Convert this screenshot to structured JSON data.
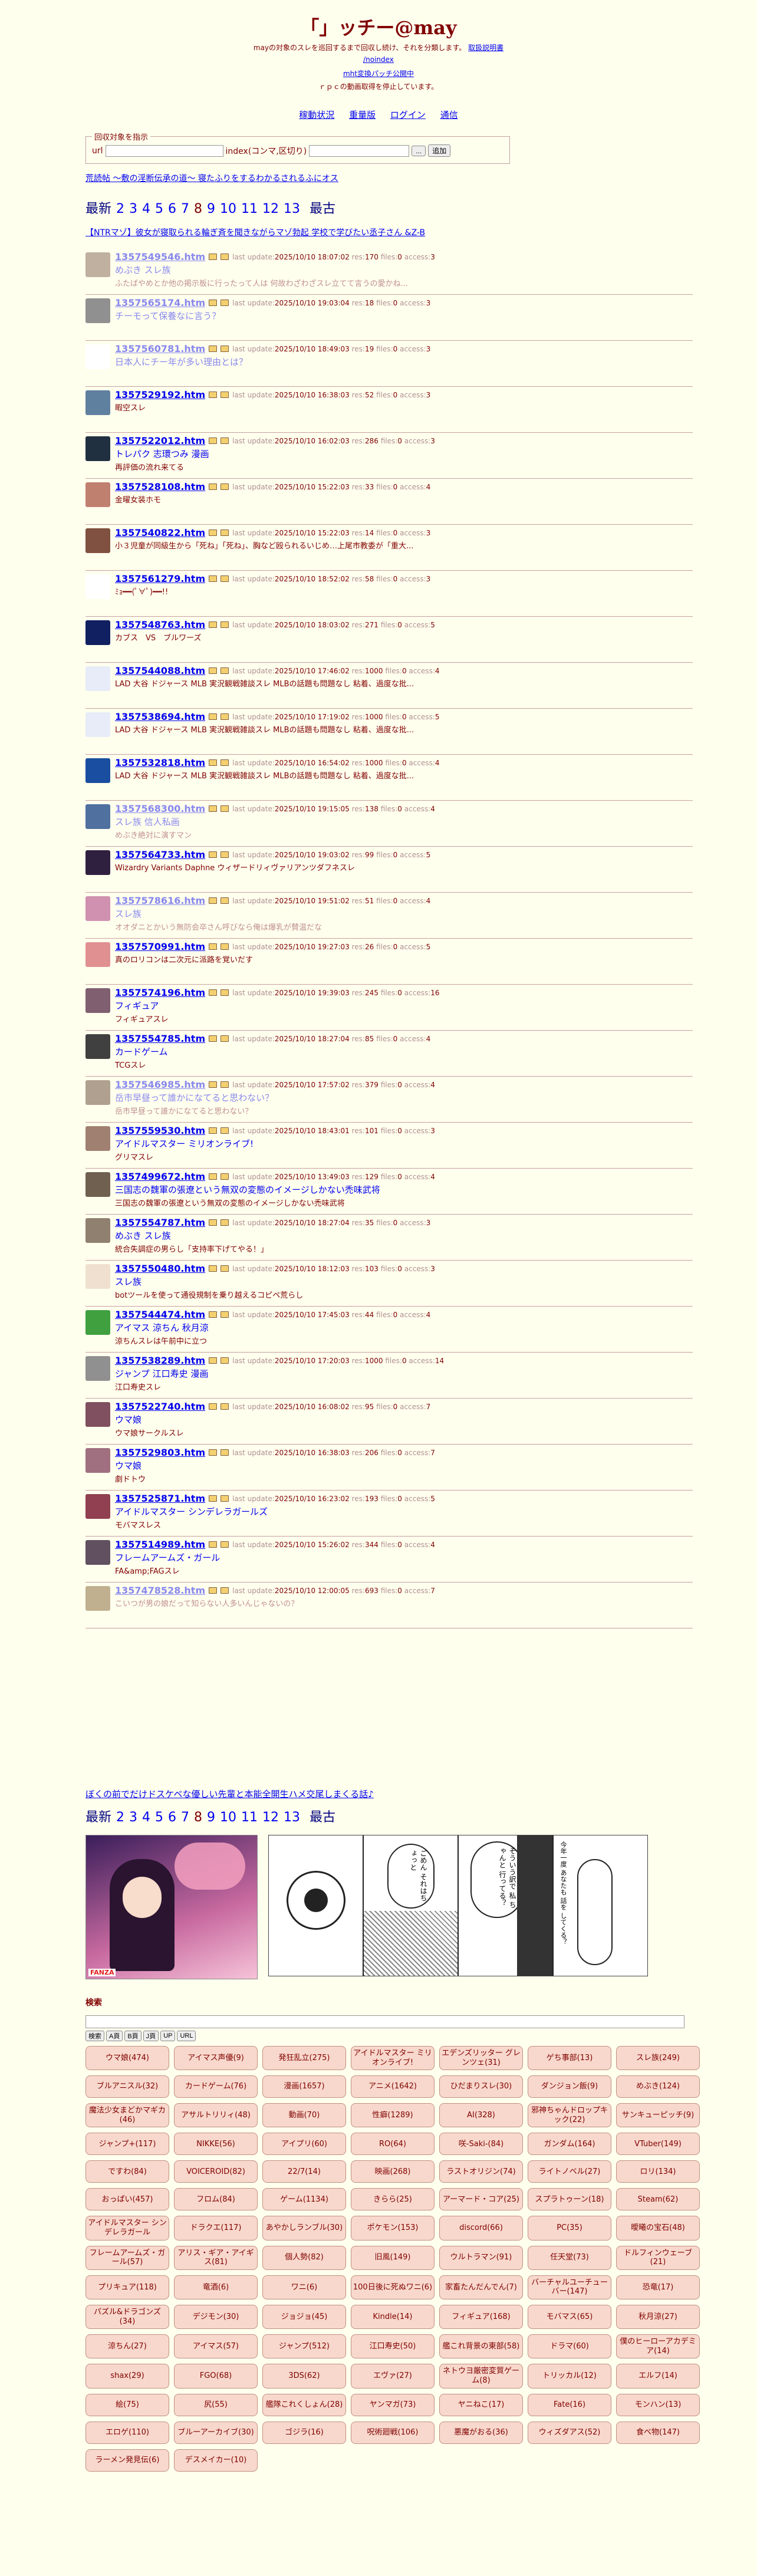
{
  "site_title": "「」ッチー@may",
  "intro": {
    "line1": "mayの対象のスレを巡回するまで回収し続け、それを分類します。",
    "line1_link": "取扱説明書",
    "line2": "/noindex",
    "line3": "mht変換パッチ公開中",
    "line4": "ｒｐｃの動画取得を停止しています。"
  },
  "nav": [
    "稼動状況",
    "重量版",
    "ログイン",
    "通信"
  ],
  "form": {
    "legend": "回収対象を指示",
    "url_label": "url",
    "index_label": "index(コンマ,区切り)",
    "dots_button": "...",
    "add_button": "追加"
  },
  "tag_links": "荒読帖 〜敷の淫断伝承の道〜 寝たふりをするわかるされるふにオス",
  "pager": {
    "label_first": "最新",
    "pages": [
      "2",
      "3",
      "4",
      "5",
      "6",
      "7",
      "8",
      "9",
      "10",
      "11",
      "12",
      "13"
    ],
    "current": "8",
    "label_last": "最古"
  },
  "selection_line": "【NTRマゾ】彼女が寝取られる輪ぎ斉を聞きながらマゾ勃起 学校で学びたい丞子さん &Z-B",
  "meta_labels": {
    "last_update": "last update:",
    "res": "res:",
    "files": "files:",
    "access": "access:"
  },
  "threads": [
    {
      "id": "1357549546.htm",
      "date": "2025/10/10 18:07:02",
      "res": "170",
      "files": "0",
      "access": "3",
      "title": "めぶき スレ族",
      "sub": "ふたばやめとか他の掲示板に行ったって人は 何故わざわざスレ立てて言うの愛かね...",
      "color": "#c0b0a0",
      "dim": true
    },
    {
      "id": "1357565174.htm",
      "date": "2025/10/10 19:03:04",
      "res": "18",
      "files": "0",
      "access": "3",
      "title": "チーモって保養なに言う？",
      "sub": "",
      "color": "#909090",
      "dim": true
    },
    {
      "id": "1357560781.htm",
      "date": "2025/10/10 18:49:03",
      "res": "19",
      "files": "0",
      "access": "3",
      "title": "日本人にチー年が多い理由とは？",
      "sub": "",
      "color": "#ffffff",
      "dim": true
    },
    {
      "id": "1357529192.htm",
      "date": "2025/10/10 16:38:03",
      "res": "52",
      "files": "0",
      "access": "3",
      "title": "",
      "sub": "暇空スレ",
      "color": "#6080a0",
      "dim": false
    },
    {
      "id": "1357522012.htm",
      "date": "2025/10/10 16:02:03",
      "res": "286",
      "files": "0",
      "access": "3",
      "title": "トレパク 志環つみ 漫画",
      "sub": "再評価の流れ来てる",
      "color": "#203040",
      "dim": false
    },
    {
      "id": "1357528108.htm",
      "date": "2025/10/10 15:22:03",
      "res": "33",
      "files": "0",
      "access": "4",
      "title": "",
      "sub": "金曜女装ホモ",
      "color": "#c08070",
      "dim": false
    },
    {
      "id": "1357540822.htm",
      "date": "2025/10/10 15:22:03",
      "res": "14",
      "files": "0",
      "access": "3",
      "title": "",
      "sub": "小３児童が同級生から「死ね」「死ね」、胸など殴られるいじめ…上尾市教委が「重大...",
      "color": "#805040",
      "dim": false
    },
    {
      "id": "1357561279.htm",
      "date": "2025/10/10 18:52:02",
      "res": "58",
      "files": "0",
      "access": "3",
      "title": "",
      "sub": "ﾐｮ━━(ﾟ∀ﾟ)━━!!",
      "color": "#ffffff",
      "dim": false
    },
    {
      "id": "1357548763.htm",
      "date": "2025/10/10 18:03:02",
      "res": "271",
      "files": "0",
      "access": "5",
      "title": "",
      "sub": "カブス　VS　ブルワーズ",
      "color": "#102060",
      "dim": false
    },
    {
      "id": "1357544088.htm",
      "date": "2025/10/10 17:46:02",
      "res": "1000",
      "files": "0",
      "access": "4",
      "title": "",
      "sub": "LAD 大谷 ドジャース MLB 実況観戦雑談スレ MLBの話題も問題なし 粘着、過度な批...",
      "color": "#e8ecf8",
      "dim": false
    },
    {
      "id": "1357538694.htm",
      "date": "2025/10/10 17:19:02",
      "res": "1000",
      "files": "0",
      "access": "5",
      "title": "",
      "sub": "LAD 大谷 ドジャース MLB 実況観戦雑談スレ MLBの話題も問題なし 粘着、過度な批...",
      "color": "#e8ecf8",
      "dim": false
    },
    {
      "id": "1357532818.htm",
      "date": "2025/10/10 16:54:02",
      "res": "1000",
      "files": "0",
      "access": "4",
      "title": "",
      "sub": "LAD 大谷 ドジャース MLB 実況観戦雑談スレ MLBの話題も問題なし 粘着、過度な批...",
      "color": "#1a4ea0",
      "dim": false
    },
    {
      "id": "1357568300.htm",
      "date": "2025/10/10 19:15:05",
      "res": "138",
      "files": "0",
      "access": "4",
      "title": "スレ族 信人私画",
      "sub": "めぶき絶対に演すマン",
      "color": "#5070a0",
      "dim": true
    },
    {
      "id": "1357564733.htm",
      "date": "2025/10/10 19:03:02",
      "res": "99",
      "files": "0",
      "access": "5",
      "title": "",
      "sub": "Wizardry Variants Daphne ウィザードリィヴァリアンツダフネスレ",
      "color": "#302040",
      "dim": false
    },
    {
      "id": "1357578616.htm",
      "date": "2025/10/10 19:51:02",
      "res": "51",
      "files": "0",
      "access": "4",
      "title": "スレ族",
      "sub": "オオダニとかいう無防会卒さん呼びなら俺は爆乳が賛温だな",
      "color": "#d090b0",
      "dim": true
    },
    {
      "id": "1357570991.htm",
      "date": "2025/10/10 19:27:03",
      "res": "26",
      "files": "0",
      "access": "5",
      "title": "",
      "sub": "真のロリコンは二次元に派路を覚いだす",
      "color": "#e09090",
      "dim": false
    },
    {
      "id": "1357574196.htm",
      "date": "2025/10/10 19:39:03",
      "res": "245",
      "files": "0",
      "access": "16",
      "title": "フィギュア",
      "sub": "フィギュアスレ",
      "color": "#806070",
      "dim": false
    },
    {
      "id": "1357554785.htm",
      "date": "2025/10/10 18:27:04",
      "res": "85",
      "files": "0",
      "access": "4",
      "title": "カードゲーム",
      "sub": "TCGスレ",
      "color": "#404040",
      "dim": false
    },
    {
      "id": "1357546985.htm",
      "date": "2025/10/10 17:57:02",
      "res": "379",
      "files": "0",
      "access": "4",
      "title": "岳市早昼って誰かになてると思わない？",
      "sub": "岳市早昼って誰かになてると思わない？",
      "color": "#b0a090",
      "dim": true
    },
    {
      "id": "1357559530.htm",
      "date": "2025/10/10 18:43:01",
      "res": "101",
      "files": "0",
      "access": "3",
      "title": "アイドルマスター ミリオンライブ!",
      "sub": "グリマスレ",
      "color": "#a08070",
      "dim": false
    },
    {
      "id": "1357499672.htm",
      "date": "2025/10/10 13:49:03",
      "res": "129",
      "files": "0",
      "access": "4",
      "title": "三国志の魏軍の張遼という無双の変態のイメージしかない禿味武将",
      "sub": "三国志の魏軍の張遼という無双の変態のイメージしかない禿味武将",
      "color": "#706050",
      "dim": false
    },
    {
      "id": "1357554787.htm",
      "date": "2025/10/10 18:27:04",
      "res": "35",
      "files": "0",
      "access": "3",
      "title": "めぶき スレ族",
      "sub": "統合失調症の男らし「支持率下げてやる！」",
      "color": "#908070",
      "dim": false
    },
    {
      "id": "1357550480.htm",
      "date": "2025/10/10 18:12:03",
      "res": "103",
      "files": "0",
      "access": "3",
      "title": "スレ族",
      "sub": "botツールを使って通役規制を乗り越えるコピペ荒らし",
      "color": "#f0e0d0",
      "dim": false
    },
    {
      "id": "1357544474.htm",
      "date": "2025/10/10 17:45:03",
      "res": "44",
      "files": "0",
      "access": "4",
      "title": "アイマス 涼ちん 秋月涼",
      "sub": "涼ちんスレは午前中に立つ",
      "color": "#40a040",
      "dim": false
    },
    {
      "id": "1357538289.htm",
      "date": "2025/10/10 17:20:03",
      "res": "1000",
      "files": "0",
      "access": "14",
      "title": "ジャンプ 江口寿史 漫画",
      "sub": "江口寿史スレ",
      "color": "#909090",
      "dim": false
    },
    {
      "id": "1357522740.htm",
      "date": "2025/10/10 16:08:02",
      "res": "95",
      "files": "0",
      "access": "7",
      "title": "ウマ娘",
      "sub": "ウマ娘サークルスレ",
      "color": "#805060",
      "dim": false
    },
    {
      "id": "1357529803.htm",
      "date": "2025/10/10 16:38:03",
      "res": "206",
      "files": "0",
      "access": "7",
      "title": "ウマ娘",
      "sub": "劇ドトウ",
      "color": "#a07080",
      "dim": false
    },
    {
      "id": "1357525871.htm",
      "date": "2025/10/10 16:23:02",
      "res": "193",
      "files": "0",
      "access": "5",
      "title": "アイドルマスター シンデレラガールズ",
      "sub": "モバマスレス",
      "color": "#904050",
      "dim": false
    },
    {
      "id": "1357514989.htm",
      "date": "2025/10/10 15:26:02",
      "res": "344",
      "files": "0",
      "access": "4",
      "title": "フレームアームズ・ガール",
      "sub": "FA&amp;FAGスレ",
      "color": "#605060",
      "dim": false
    },
    {
      "id": "1357478528.htm",
      "date": "2025/10/10 12:00:05",
      "res": "693",
      "files": "0",
      "access": "7",
      "title": "",
      "sub": "こいつが男の娘だって知らない人多いんじゃないの？",
      "color": "#c0b090",
      "dim": true
    }
  ],
  "footer_link": "ぼくの前でだけドスケベな優しい先輩と本能全開生ハメ交尾しまくる話♪",
  "banner": {
    "brand": "FANZA",
    "panel_text_1": "ごめん それはちょっと",
    "panel_text_2": "そういう訳で 私 ちゃんと 行ってる？",
    "panel_text_3": "今年一度 あなたも 話を してくる？"
  },
  "search": {
    "heading": "検索",
    "buttons": [
      "検索",
      "A頁",
      "B頁",
      "J頁",
      "UP",
      "URL"
    ]
  },
  "tags": [
    "ウマ娘(474)",
    "アイマス声優(9)",
    "発狂乱立(275)",
    "アイドルマスター ミリオンライブ!",
    "エデンズリッター グレンツェ(31)",
    "ゲち事部(13)",
    "スレ族(249)",
    "ブルアニスル(32)",
    "カードゲーム(76)",
    "漫画(1657)",
    "アニメ(1642)",
    "ひだまりスレ(30)",
    "ダンジョン飯(9)",
    "めぶき(124)",
    "魔法少女まどかマギカ(46)",
    "アサルトリリィ(48)",
    "動画(70)",
    "性癖(1289)",
    "AI(328)",
    "邪神ちゃんドロップキック(22)",
    "サンキューピッチ(9)",
    "ジャンプ+(117)",
    "NIKKE(56)",
    "アイプリ(60)",
    "RO(64)",
    "咲-Saki-(84)",
    "ガンダム(164)",
    "VTuber(149)",
    "ですわ(84)",
    "VOICEROID(82)",
    "22/7(14)",
    "映画(268)",
    "ラストオリジン(74)",
    "ライトノベル(27)",
    "ロリ(134)",
    "おっぱい(457)",
    "フロム(84)",
    "ゲーム(1134)",
    "きらら(25)",
    "アーマード・コア(25)",
    "スプラトゥーン(18)",
    "Steam(62)",
    "アイドルマスター シンデレラガール",
    "ドラクエ(117)",
    "あやかしランブル(30)",
    "ポケモン(153)",
    "discord(66)",
    "PC(35)",
    "曖曦の宝石(48)",
    "フレームアームズ・ガール(57)",
    "アリス・ギア・アイギス(81)",
    "個人勢(82)",
    "旧風(149)",
    "ウルトラマン(91)",
    "任天堂(73)",
    "ドルフィンウェーブ(21)",
    "プリキュア(118)",
    "竜酒(6)",
    "ワニ(6)",
    "100日後に死ぬワニ(6)",
    "家畜たんだんでん(7)",
    "バーチャルユーチューバー(147)",
    "恐竜(17)",
    "パズル&ドラゴンズ(34)",
    "デジモン(30)",
    "ジョジョ(45)",
    "Kindle(14)",
    "フィギュア(168)",
    "モバマス(65)",
    "秋月涼(27)",
    "涼ちん(27)",
    "アイマス(57)",
    "ジャンプ(512)",
    "江口寿史(50)",
    "艦これ背景の東部(58)",
    "ドラマ(60)",
    "僕のヒーローアカデミア(14)",
    "shax(29)",
    "FGO(68)",
    "3DS(62)",
    "エヴァ(27)",
    "ネトウヨ厳密変質ゲーム(8)",
    "トリッカル(12)",
    "エルフ(14)",
    "絵(75)",
    "尻(55)",
    "艦隊これくしょん(28)",
    "ヤンマガ(73)",
    "ヤニねこ(17)",
    "Fate(16)",
    "モンハン(13)",
    "エロゲ(110)",
    "ブルーアーカイブ(30)",
    "ゴジラ(16)",
    "呪術廻戦(106)",
    "悪魔がおる(36)",
    "ウィズダアス(52)",
    "食べ物(147)",
    "ラーメン発見伝(6)",
    "デスメイカー(10)"
  ]
}
